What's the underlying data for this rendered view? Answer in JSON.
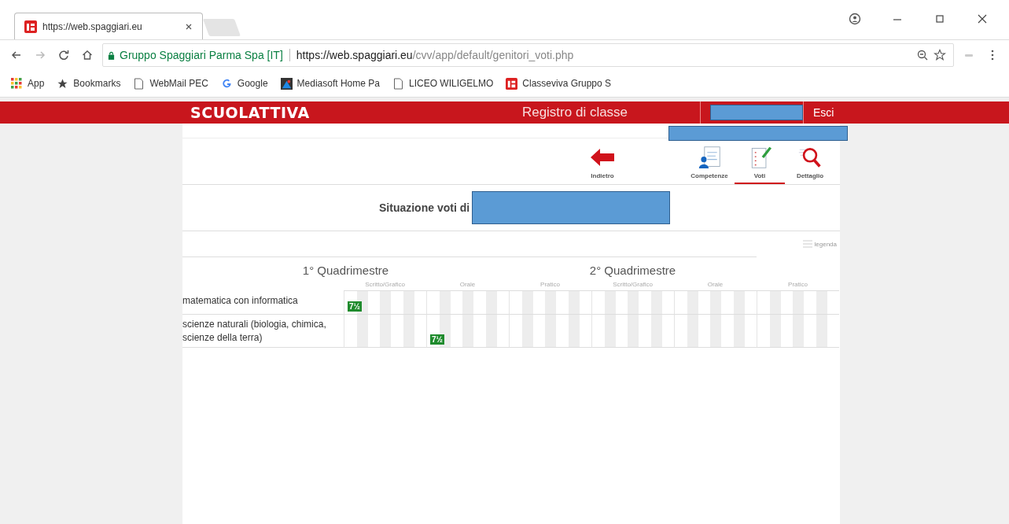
{
  "browser": {
    "tab_title": "https://web.spaggiari.eu",
    "site_identity": "Gruppo Spaggiari Parma Spa [IT]",
    "url_origin": "https://web.spaggiari.eu",
    "url_path": "/cvv/app/default/genitori_voti.php",
    "bookmarks": [
      {
        "label": "App",
        "kind": "apps"
      },
      {
        "label": "Bookmarks",
        "kind": "star"
      },
      {
        "label": "WebMail PEC",
        "kind": "page"
      },
      {
        "label": "Google",
        "kind": "google"
      },
      {
        "label": "Mediasoft Home Pa",
        "kind": "mediasoft"
      },
      {
        "label": "LICEO WILIGELMO",
        "kind": "page"
      },
      {
        "label": "Classeviva Gruppo S",
        "kind": "classeviva"
      }
    ]
  },
  "header": {
    "logo": "SCUOLATTIVA",
    "title": "Registro di classe",
    "logout": "Esci"
  },
  "toolbar": [
    {
      "label": "Indietro",
      "kind": "back",
      "selected": false
    },
    {
      "label": "Competenze",
      "kind": "skills",
      "selected": false
    },
    {
      "label": "Voti",
      "kind": "grades",
      "selected": true
    },
    {
      "label": "Dettaglio",
      "kind": "detail",
      "selected": false
    }
  ],
  "page_title": "Situazione voti di",
  "legend": "legenda",
  "table": {
    "periods": [
      {
        "name": "1° Quadrimestre",
        "columns": [
          "Scritto/Grafico",
          "Orale",
          "Pratico"
        ]
      },
      {
        "name": "2° Quadrimestre",
        "columns": [
          "Scritto/Grafico",
          "Orale",
          "Pratico"
        ]
      }
    ],
    "rows": [
      {
        "subject": "matematica con informatica",
        "cells": [
          {
            "grade": "7½"
          },
          {},
          {},
          {},
          {},
          {}
        ]
      },
      {
        "subject": "scienze naturali (biologia, chimica, scienze della terra)",
        "cells": [
          {},
          {
            "grade": "7½"
          },
          {},
          {},
          {},
          {}
        ]
      }
    ]
  }
}
